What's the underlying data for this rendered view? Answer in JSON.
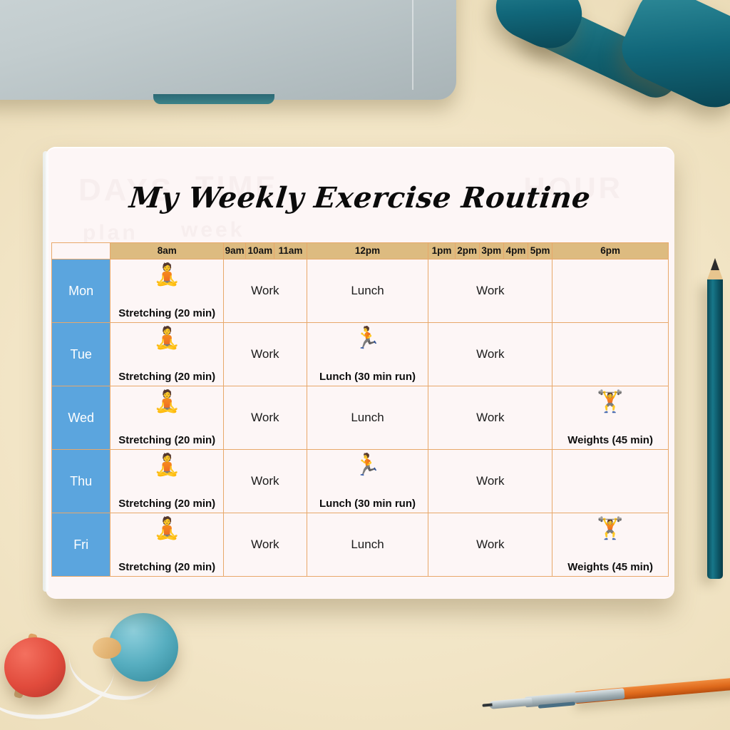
{
  "scene": {
    "objects": [
      {
        "name": "laptop",
        "color": "#c2ccce"
      },
      {
        "name": "dumbbell",
        "color": "#116170"
      },
      {
        "name": "pencil",
        "color": "#0d5767"
      },
      {
        "name": "pen",
        "color": "#df6a1c"
      },
      {
        "name": "earbud-red",
        "color": "#e14b3c"
      },
      {
        "name": "earbud-teal",
        "color": "#57aec0"
      }
    ],
    "background_color": "#f2e5c6"
  },
  "card": {
    "title": "My Weekly Exercise Routine",
    "background_color": "#fdf6f6",
    "watermarks": [
      "DAYS",
      "TIME",
      "HOUR",
      "plan",
      "week"
    ]
  },
  "colors": {
    "header_tan": "#ddbb80",
    "day_blue": "#5ba5de",
    "grid_orange": "#e8a86a",
    "text_dark": "#0d0d0d"
  },
  "table": {
    "corner_label": "",
    "time_headers": [
      {
        "label": "8am",
        "span": 1
      },
      {
        "label": "9am",
        "span": 1
      },
      {
        "label": "10am",
        "span": 1
      },
      {
        "label": "11am",
        "span": 1
      },
      {
        "label": "12pm",
        "span": 1
      },
      {
        "label": "1pm",
        "span": 1
      },
      {
        "label": "2pm",
        "span": 1
      },
      {
        "label": "3pm",
        "span": 1
      },
      {
        "label": "4pm",
        "span": 1
      },
      {
        "label": "5pm",
        "span": 1
      },
      {
        "label": "6pm",
        "span": 1
      }
    ],
    "rows": [
      {
        "day": "Mon",
        "cells": [
          {
            "text": "",
            "label": "Stretching (20 min)",
            "icon": "🧘",
            "span": 1,
            "type": "activity"
          },
          {
            "text": "Work",
            "label": "",
            "icon": "",
            "span": 3,
            "type": "plain"
          },
          {
            "text": "Lunch",
            "label": "",
            "icon": "",
            "span": 1,
            "type": "plain"
          },
          {
            "text": "Work",
            "label": "",
            "icon": "",
            "span": 5,
            "type": "plain"
          },
          {
            "text": "",
            "label": "",
            "icon": "",
            "span": 1,
            "type": "empty"
          }
        ]
      },
      {
        "day": "Tue",
        "cells": [
          {
            "text": "",
            "label": "Stretching (20 min)",
            "icon": "🧘",
            "span": 1,
            "type": "activity"
          },
          {
            "text": "Work",
            "label": "",
            "icon": "",
            "span": 3,
            "type": "plain"
          },
          {
            "text": "",
            "label": "Lunch (30 min run)",
            "icon": "🏃",
            "span": 1,
            "type": "activity"
          },
          {
            "text": "Work",
            "label": "",
            "icon": "",
            "span": 5,
            "type": "plain"
          },
          {
            "text": "",
            "label": "",
            "icon": "",
            "span": 1,
            "type": "empty"
          }
        ]
      },
      {
        "day": "Wed",
        "cells": [
          {
            "text": "",
            "label": "Stretching (20 min)",
            "icon": "🧘",
            "span": 1,
            "type": "activity"
          },
          {
            "text": "Work",
            "label": "",
            "icon": "",
            "span": 3,
            "type": "plain"
          },
          {
            "text": "Lunch",
            "label": "",
            "icon": "",
            "span": 1,
            "type": "plain"
          },
          {
            "text": "Work",
            "label": "",
            "icon": "",
            "span": 5,
            "type": "plain"
          },
          {
            "text": "",
            "label": "Weights (45 min)",
            "icon": "🏋",
            "span": 1,
            "type": "activity"
          }
        ]
      },
      {
        "day": "Thu",
        "cells": [
          {
            "text": "",
            "label": "Stretching (20 min)",
            "icon": "🧘",
            "span": 1,
            "type": "activity"
          },
          {
            "text": "Work",
            "label": "",
            "icon": "",
            "span": 3,
            "type": "plain"
          },
          {
            "text": "",
            "label": "Lunch (30 min run)",
            "icon": "🏃",
            "span": 1,
            "type": "activity"
          },
          {
            "text": "Work",
            "label": "",
            "icon": "",
            "span": 5,
            "type": "plain"
          },
          {
            "text": "",
            "label": "",
            "icon": "",
            "span": 1,
            "type": "empty"
          }
        ]
      },
      {
        "day": "Fri",
        "cells": [
          {
            "text": "",
            "label": "Stretching (20 min)",
            "icon": "🧘",
            "span": 1,
            "type": "activity"
          },
          {
            "text": "Work",
            "label": "",
            "icon": "",
            "span": 3,
            "type": "plain"
          },
          {
            "text": "Lunch",
            "label": "",
            "icon": "",
            "span": 1,
            "type": "plain"
          },
          {
            "text": "Work",
            "label": "",
            "icon": "",
            "span": 5,
            "type": "plain"
          },
          {
            "text": "",
            "label": "Weights (45 min)",
            "icon": "🏋",
            "span": 1,
            "type": "activity"
          }
        ]
      }
    ]
  }
}
